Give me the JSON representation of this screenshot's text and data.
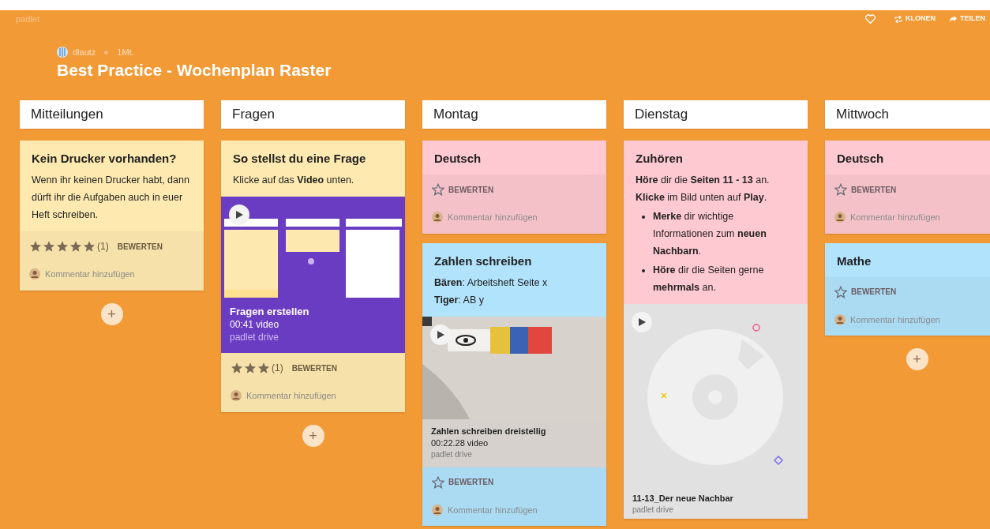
{
  "app": {
    "brand": "padlet",
    "actions": [
      {
        "kind": "like"
      },
      {
        "kind": "clone",
        "label": "KLONEN"
      },
      {
        "kind": "share",
        "label": "TEILEN"
      }
    ]
  },
  "board": {
    "author": "dlautz",
    "age": "1Mt.",
    "title": "Best Practice - Wochenplan Raster"
  },
  "columns": [
    {
      "title": "Mitteilungen",
      "add": "+",
      "posts": [
        {
          "color": "#feeab0",
          "title": "Kein Drucker vorhanden?",
          "body": [
            {
              "kind": "p",
              "text": "Wenn ihr keinen Drucker habt, dann dürft ihr die Aufgaben auch in euer Heft schreiben."
            }
          ],
          "stars": 5,
          "rating_count": "(1)",
          "rate": "BEWERTEN",
          "comment": "Kommentar hinzufügen"
        }
      ]
    },
    {
      "title": "Fragen",
      "add": "+",
      "posts": [
        {
          "color": "#feeab0",
          "title": "So stellst du eine Frage",
          "body": [
            {
              "kind": "p",
              "text": "Klicke auf das **Video** unten."
            }
          ],
          "attachment": {
            "kind": "video",
            "title": "Fragen erstellen",
            "meta": "00:41 video",
            "source": "padlet drive"
          },
          "stars": 3,
          "rating_count": "(1)",
          "rate": "BEWERTEN",
          "comment": "Kommentar hinzufügen"
        }
      ]
    },
    {
      "title": "Montag",
      "posts": [
        {
          "color": "#fec9d1",
          "title": "Deutsch",
          "rate": "BEWERTEN",
          "comment": "Kommentar hinzufügen"
        },
        {
          "color": "#b1e3fc",
          "title": "Zahlen schreiben",
          "body": [
            {
              "kind": "p",
              "text": "**Bären**: Arbeitsheft Seite x"
            },
            {
              "kind": "p",
              "text": "**Tiger**: AB y"
            }
          ],
          "attachment": {
            "kind": "video",
            "title": "Zahlen schreiben dreistellig",
            "meta": "00:22.28 video",
            "source": "padlet drive"
          },
          "rate": "BEWERTEN",
          "comment": "Kommentar hinzufügen"
        }
      ]
    },
    {
      "title": "Dienstag",
      "posts": [
        {
          "color": "#fec9d1",
          "title": "Zuhören",
          "body": [
            {
              "kind": "p",
              "text": "**Höre** dir die **Seiten 11 - 13** an."
            },
            {
              "kind": "p",
              "text": "**Klicke** im Bild unten auf **Play**."
            },
            {
              "kind": "bullet",
              "text": "**Merke** dir wichtige Informationen zum **neuen Nachbarn**."
            },
            {
              "kind": "bullet",
              "text": "**Höre** dir die Seiten gerne **mehrmals** an."
            }
          ],
          "attachment": {
            "kind": "audio",
            "title": "11-13_Der neue Nachbar",
            "source": "padlet drive"
          }
        }
      ]
    },
    {
      "title": "Mittwoch",
      "add": "+",
      "posts": [
        {
          "color": "#fec9d1",
          "title": "Deutsch",
          "rate": "BEWERTEN",
          "comment": "Kommentar hinzufügen"
        },
        {
          "color": "#b1e3fc",
          "title": "Mathe",
          "rate": "BEWERTEN",
          "comment": "Kommentar hinzufügen"
        }
      ]
    }
  ]
}
